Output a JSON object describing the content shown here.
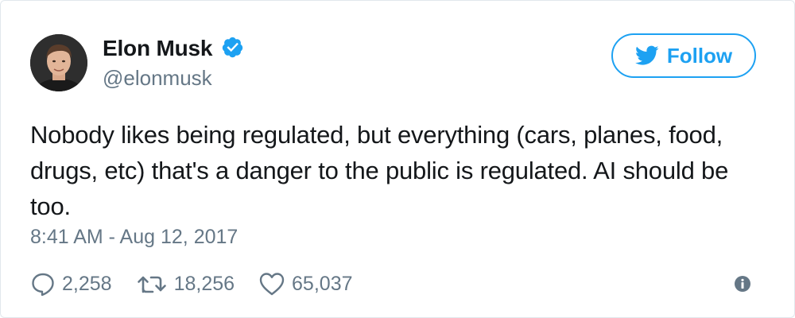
{
  "author": {
    "display_name": "Elon Musk",
    "handle": "@elonmusk",
    "verified": true
  },
  "follow_button": {
    "label": "Follow"
  },
  "tweet": {
    "text": "Nobody likes being regulated, but everything (cars, planes, food, drugs, etc) that's a danger to the public is regulated. AI should be too.",
    "timestamp": "8:41 AM - Aug 12, 2017"
  },
  "actions": {
    "replies": "2,258",
    "retweets": "18,256",
    "likes": "65,037"
  },
  "icons": {
    "verified": "verified-badge-icon",
    "bird": "twitter-bird-icon",
    "reply": "reply-icon",
    "retweet": "retweet-icon",
    "like": "heart-icon",
    "info": "info-icon"
  },
  "colors": {
    "accent": "#1da1f2",
    "text": "#14171a",
    "muted": "#657786",
    "border": "#e1e8ed"
  }
}
